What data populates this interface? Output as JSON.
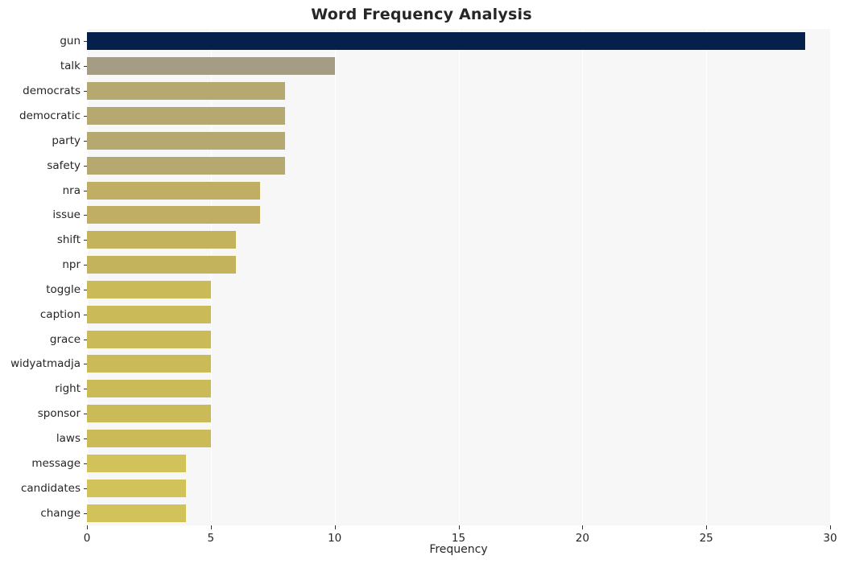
{
  "chart_data": {
    "type": "bar",
    "orientation": "horizontal",
    "title": "Word Frequency Analysis",
    "xlabel": "Frequency",
    "ylabel": "",
    "xlim": [
      0,
      30
    ],
    "xticks": [
      0,
      5,
      10,
      15,
      20,
      25,
      30
    ],
    "grid": "vertical",
    "legend": "none",
    "categories": [
      "gun",
      "talk",
      "democrats",
      "democratic",
      "party",
      "safety",
      "nra",
      "issue",
      "shift",
      "npr",
      "toggle",
      "caption",
      "grace",
      "widyatmadja",
      "right",
      "sponsor",
      "laws",
      "message",
      "candidates",
      "change"
    ],
    "values": [
      29,
      10,
      8,
      8,
      8,
      8,
      7,
      7,
      6,
      6,
      5,
      5,
      5,
      5,
      5,
      5,
      5,
      4,
      4,
      4
    ],
    "bar_colors": [
      "#05204a",
      "#a59c84",
      "#b5a96f",
      "#b5a96f",
      "#b5a96f",
      "#b5a96f",
      "#bfae63",
      "#bfae63",
      "#c4b35d",
      "#c4b35d",
      "#cbbb58",
      "#cbbb58",
      "#cbbb58",
      "#cbbb58",
      "#cbbb58",
      "#cbbb58",
      "#cbbb58",
      "#d2c25a",
      "#d2c25a",
      "#d2c25a"
    ],
    "plot_background": "#f7f7f7",
    "gridline_color": "#ffffff",
    "text_color": "#262626"
  }
}
